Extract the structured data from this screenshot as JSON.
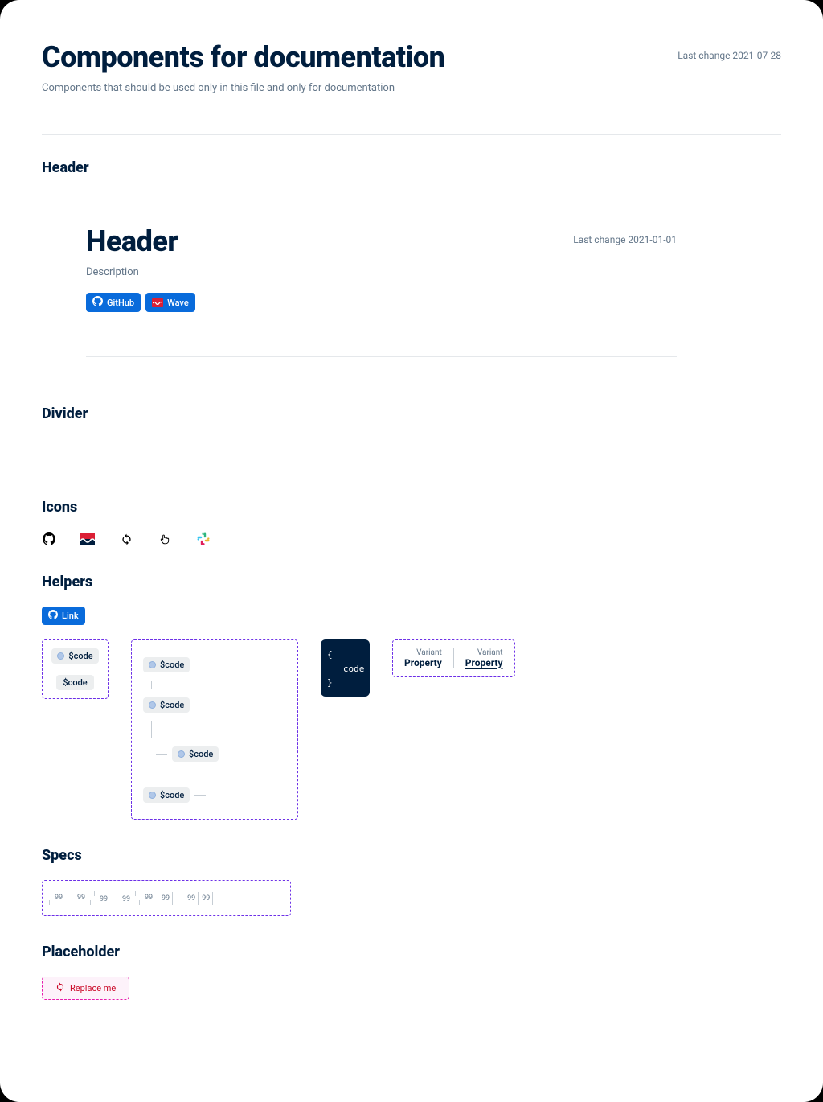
{
  "page": {
    "title": "Components for documentation",
    "subtitle": "Components that should be used only in this file and only for documentation",
    "last_change": "Last change 2021-07-28"
  },
  "sections": {
    "header": {
      "title": "Header",
      "example": {
        "title": "Header",
        "description": "Description",
        "last_change": "Last change 2021-01-01",
        "links": {
          "github": "GitHub",
          "wave": "Wave"
        }
      }
    },
    "divider": {
      "title": "Divider"
    },
    "icons": {
      "title": "Icons",
      "items": [
        "github-icon",
        "wave-icon",
        "sync-icon",
        "pointer-icon",
        "slack-icon"
      ]
    },
    "helpers": {
      "title": "Helpers",
      "link_label": "Link",
      "code_label": "$code",
      "code_block": {
        "line1": "{",
        "line2": "   code",
        "line3": "}"
      },
      "variant": {
        "label": "Variant",
        "property": "Property"
      }
    },
    "specs": {
      "title": "Specs",
      "value": "99"
    },
    "placeholder": {
      "title": "Placeholder",
      "label": "Replace me"
    }
  }
}
